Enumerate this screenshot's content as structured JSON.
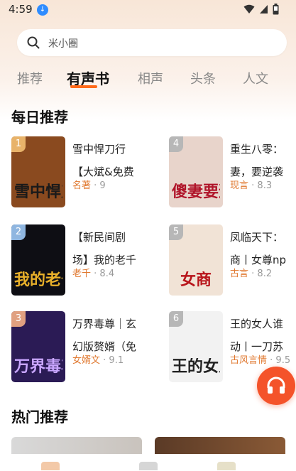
{
  "status_bar": {
    "time": "4:59",
    "badge": "↓"
  },
  "search": {
    "placeholder": "米小圈"
  },
  "tabs": [
    {
      "label": "推荐"
    },
    {
      "label": "有声书"
    },
    {
      "label": "相声"
    },
    {
      "label": "头条"
    },
    {
      "label": "人文"
    }
  ],
  "daily": {
    "title": "每日推荐",
    "books": [
      {
        "rank": "1",
        "line1": "雪中悍刀行",
        "line2": "【大斌&免费",
        "tag": "名著",
        "rating": "· 9",
        "cover_text": "雪中悍刀行",
        "cover_bg": "#8a4a1f",
        "cover_fg": "#1a1a1a"
      },
      {
        "rank": "2",
        "line1": "【新民间剧",
        "line2": "场】我的老千",
        "tag": "老千",
        "rating": "· 8.4",
        "cover_text": "我的老千",
        "cover_bg": "#0e0e14",
        "cover_fg": "#e8b02a"
      },
      {
        "rank": "3",
        "line1": "万界毒尊｜玄",
        "line2": "幻版赘婿（免",
        "tag": "女婿文",
        "rating": "· 9.1",
        "cover_text": "万界毒尊",
        "cover_bg": "#2b1b55",
        "cover_fg": "#c9a6ff"
      },
      {
        "rank": "4",
        "line1": "重生八零：",
        "line2": "妻，要逆袭",
        "tag": "现言",
        "rating": "· 8.3",
        "cover_text": "傻妻要逆袭",
        "cover_bg": "#e8d4cb",
        "cover_fg": "#b0152a"
      },
      {
        "rank": "5",
        "line1": "凤临天下：",
        "line2": "商丨女尊np",
        "tag": "古言",
        "rating": "· 8.2",
        "cover_text": "女商",
        "cover_bg": "#f1e3d6",
        "cover_fg": "#b8151b"
      },
      {
        "rank": "6",
        "line1": "王的女人谁",
        "line2": "动丨一刀苏",
        "tag": "古风言情",
        "rating": "· 9.5",
        "cover_text": "王的女人",
        "cover_bg": "#f2f2f2",
        "cover_fg": "#222222"
      }
    ]
  },
  "hot": {
    "title": "热门推荐"
  },
  "colors": {
    "accent": "#ff6a1a",
    "tag": "#e0782f",
    "fab": "#f4532a",
    "rank_colors": [
      "#e8b36a",
      "#8fb6e0",
      "#e0a080",
      "#b7b7b7",
      "#b7b7b7",
      "#b7b7b7"
    ]
  },
  "icons": {
    "search": "search-icon",
    "headphones": "headphones-icon",
    "wifi": "wifi-icon",
    "signal": "signal-icon",
    "battery": "battery-icon"
  }
}
